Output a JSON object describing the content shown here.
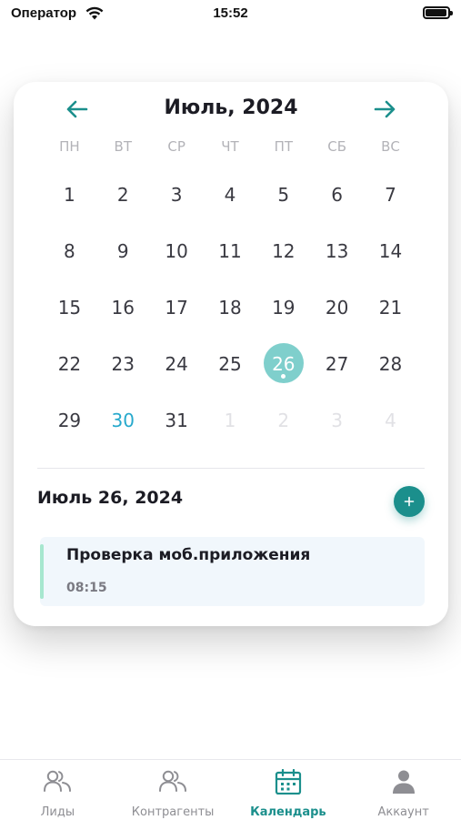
{
  "status_bar": {
    "carrier": "Оператор",
    "time": "15:52"
  },
  "calendar": {
    "month_title": "Июль, 2024",
    "weekdays": [
      "ПН",
      "ВТ",
      "СР",
      "ЧТ",
      "ПТ",
      "СБ",
      "ВС"
    ],
    "weeks": [
      [
        {
          "d": "1",
          "other": false
        },
        {
          "d": "2",
          "other": false
        },
        {
          "d": "3",
          "other": false
        },
        {
          "d": "4",
          "other": false
        },
        {
          "d": "5",
          "other": false
        },
        {
          "d": "6",
          "other": false
        },
        {
          "d": "7",
          "other": false
        }
      ],
      [
        {
          "d": "8",
          "other": false
        },
        {
          "d": "9",
          "other": false
        },
        {
          "d": "10",
          "other": false
        },
        {
          "d": "11",
          "other": false
        },
        {
          "d": "12",
          "other": false
        },
        {
          "d": "13",
          "other": false
        },
        {
          "d": "14",
          "other": false
        }
      ],
      [
        {
          "d": "15",
          "other": false
        },
        {
          "d": "16",
          "other": false
        },
        {
          "d": "17",
          "other": false
        },
        {
          "d": "18",
          "other": false
        },
        {
          "d": "19",
          "other": false
        },
        {
          "d": "20",
          "other": false
        },
        {
          "d": "21",
          "other": false
        }
      ],
      [
        {
          "d": "22",
          "other": false
        },
        {
          "d": "23",
          "other": false
        },
        {
          "d": "24",
          "other": false
        },
        {
          "d": "25",
          "other": false
        },
        {
          "d": "26",
          "other": false,
          "selected": true,
          "has_event": true
        },
        {
          "d": "27",
          "other": false
        },
        {
          "d": "28",
          "other": false
        }
      ],
      [
        {
          "d": "29",
          "other": false
        },
        {
          "d": "30",
          "other": false,
          "today": true
        },
        {
          "d": "31",
          "other": false
        },
        {
          "d": "1",
          "other": true
        },
        {
          "d": "2",
          "other": true
        },
        {
          "d": "3",
          "other": true
        },
        {
          "d": "4",
          "other": true
        }
      ]
    ],
    "selected_date_label": "Июль 26, 2024"
  },
  "events": [
    {
      "title": "Проверка моб.приложения",
      "time": "08:15"
    }
  ],
  "tab_bar": {
    "tabs": [
      {
        "name": "tab-leads",
        "label": "Лиды",
        "icon": "people-icon",
        "active": false
      },
      {
        "name": "tab-contractors",
        "label": "Контрагенты",
        "icon": "people-icon",
        "active": false
      },
      {
        "name": "tab-calendar",
        "label": "Календарь",
        "icon": "calendar-icon",
        "active": true
      },
      {
        "name": "tab-account",
        "label": "Аккаунт",
        "icon": "person-icon",
        "active": false
      }
    ]
  },
  "colors": {
    "accent": "#1b8f8c",
    "selected_day": "#7fcfcc",
    "today": "#26a9cc",
    "event_bar": "#a7e7cf",
    "tab_inactive": "#8e8e93"
  }
}
